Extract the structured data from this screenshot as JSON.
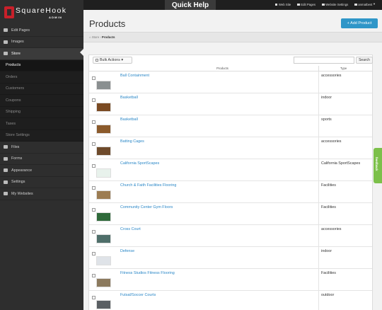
{
  "top": {
    "quick_help": "Quick Help",
    "links": [
      "Web Site",
      "Edit Pages",
      "Website Settings",
      "anmatbest"
    ]
  },
  "logo": {
    "text": "SquareHook",
    "sub": "ADMIN"
  },
  "sidebar": {
    "items": [
      {
        "label": "Edit Pages",
        "icon": "edit-icon"
      },
      {
        "label": "Images",
        "icon": "image-icon"
      },
      {
        "label": "Store",
        "icon": "cart-icon"
      }
    ],
    "store_sub": [
      "Products",
      "Orders",
      "Customers",
      "Coupons",
      "Shipping",
      "Taxes",
      "Store Settings"
    ],
    "items_after": [
      {
        "label": "Files",
        "icon": "file-icon"
      },
      {
        "label": "Forms",
        "icon": "list-icon"
      },
      {
        "label": "Appearance",
        "icon": "monitor-icon"
      },
      {
        "label": "Settings",
        "icon": "gear-icon"
      },
      {
        "label": "My Websites",
        "icon": "website-icon"
      }
    ]
  },
  "main": {
    "title": "Products",
    "add_button": "+ Add Product",
    "breadcrumb": {
      "root": "Store",
      "current": "Products"
    },
    "toolbar": {
      "bulk": "Bulk Actions",
      "search": "Search"
    },
    "columns": {
      "product": "Products",
      "type": "Type"
    },
    "rows": [
      {
        "name": "Ball Containment",
        "type": "accessories",
        "thumb": "#8a8f90"
      },
      {
        "name": "Basketball",
        "type": "indoor",
        "thumb": "#7a4a22"
      },
      {
        "name": "Basketball",
        "type": "sports",
        "thumb": "#8b5a2b"
      },
      {
        "name": "Batting Cages",
        "type": "accessories",
        "thumb": "#6e4a2b"
      },
      {
        "name": "California SportScapes",
        "type": "California SportScapes",
        "thumb": "#e8f2ec"
      },
      {
        "name": "Church & Faith Facilities Flooring",
        "type": "Facilities",
        "thumb": "#9c7c52"
      },
      {
        "name": "Community Center Gym Floors",
        "type": "Facilities",
        "thumb": "#2f6a3a"
      },
      {
        "name": "Cross Court",
        "type": "accessories",
        "thumb": "#4f6f6a"
      },
      {
        "name": "Defense",
        "type": "indoor",
        "thumb": "#dfe3e8"
      },
      {
        "name": "Fitness Studios Fitness Flooring",
        "type": "Facilities",
        "thumb": "#8c7a5e"
      },
      {
        "name": "Futsal/Soccer Courts",
        "type": "outdoor",
        "thumb": "#5a5f63"
      }
    ]
  },
  "feedback": "feedback",
  "colors": {
    "accent": "#2f96c8",
    "link": "#2a87c7",
    "feedback": "#7cc04a"
  }
}
